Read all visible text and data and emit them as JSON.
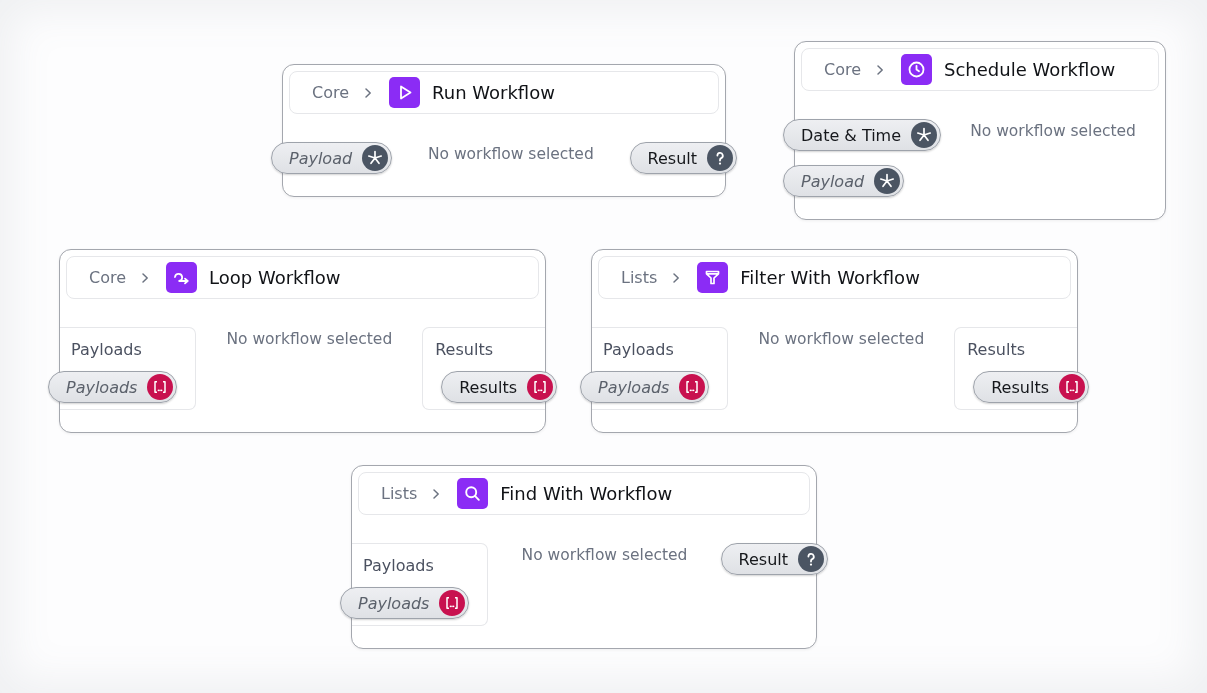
{
  "nodes": [
    {
      "category": "Core",
      "title": "Run Workflow",
      "message": "No workflow selected",
      "inputs": [
        {
          "kind": "any",
          "label": "Payload",
          "optional": true
        }
      ],
      "outputs": [
        {
          "kind": "unknown",
          "label": "Result",
          "optional": false
        }
      ]
    },
    {
      "category": "Core",
      "title": "Schedule Workflow",
      "message": "No workflow selected",
      "inputs": [
        {
          "kind": "any",
          "label": "Date & Time",
          "optional": false
        },
        {
          "kind": "any",
          "label": "Payload",
          "optional": true
        }
      ]
    },
    {
      "category": "Core",
      "title": "Loop Workflow",
      "message": "No workflow selected",
      "inputs": [
        {
          "kind": "group",
          "heading": "Payloads",
          "pins": [
            {
              "kind": "list",
              "label": "Payloads",
              "optional": true
            }
          ]
        }
      ],
      "outputs": [
        {
          "kind": "group",
          "heading": "Results",
          "pins": [
            {
              "kind": "list",
              "label": "Results",
              "optional": false
            }
          ]
        }
      ]
    },
    {
      "category": "Lists",
      "title": "Filter With Workflow",
      "message": "No workflow selected",
      "inputs": [
        {
          "kind": "group",
          "heading": "Payloads",
          "pins": [
            {
              "kind": "list",
              "label": "Payloads",
              "optional": true
            }
          ]
        }
      ],
      "outputs": [
        {
          "kind": "group",
          "heading": "Results",
          "pins": [
            {
              "kind": "list",
              "label": "Results",
              "optional": false
            }
          ]
        }
      ]
    },
    {
      "category": "Lists",
      "title": "Find With Workflow",
      "message": "No workflow selected",
      "inputs": [
        {
          "kind": "group",
          "heading": "Payloads",
          "pins": [
            {
              "kind": "list",
              "label": "Payloads",
              "optional": true
            }
          ]
        }
      ],
      "outputs": [
        {
          "kind": "unknown",
          "label": "Result",
          "optional": false
        }
      ]
    }
  ]
}
